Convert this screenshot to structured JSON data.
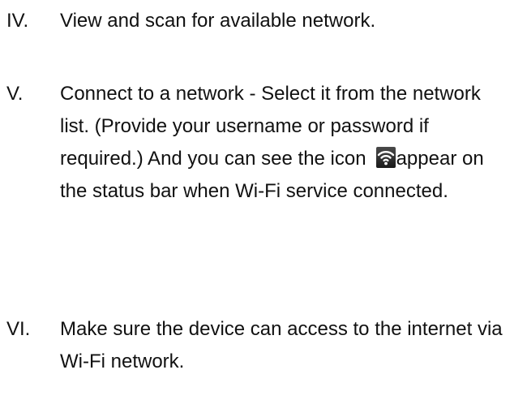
{
  "steps": [
    {
      "numeral": "IV.",
      "text": "View and scan for available network."
    },
    {
      "numeral": "V.",
      "text_part1": "Connect to a network - Select it from the network list. (Provide your username or password if required.) And you can see the icon",
      "icon": "wifi-status-icon",
      "text_part2": "appear on the status bar when Wi-Fi service connected."
    },
    {
      "numeral": "VI.",
      "text": "Make sure the device can access to the internet via Wi-Fi network."
    }
  ]
}
